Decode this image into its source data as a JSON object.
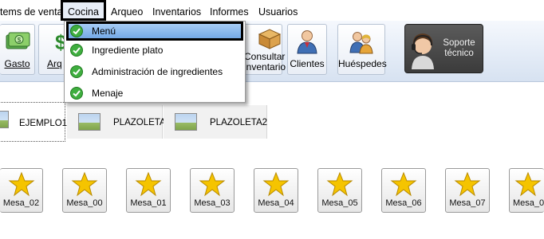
{
  "menubar": {
    "items": [
      "tems de venta",
      "Cocina",
      "Arqueo",
      "Inventarios",
      "Informes",
      "Usuarios"
    ]
  },
  "toolbar": {
    "gasto_label": "Gasto",
    "arqueo_label": "Arq",
    "consultar_label": "Consultar\ninventario",
    "clientes_label": "Clientes",
    "huespedes_label": "Huéspedes",
    "support_label": "Soporte\ntécnico"
  },
  "dropdown": {
    "items": [
      "Menú",
      "Ingrediente plato",
      "Administración de ingredientes",
      "Menaje"
    ],
    "highlighted": "Menú",
    "check_color": "#3fae3f"
  },
  "tabs": [
    "EJEMPLO1",
    "PLAZOLETA",
    "PLAZOLETA2"
  ],
  "mesas": [
    "Mesa_02",
    "Mesa_00",
    "Mesa_01",
    "Mesa_03",
    "Mesa_04",
    "Mesa_05",
    "Mesa_06",
    "Mesa_07",
    "Mesa_0"
  ],
  "colors": {
    "star": "#f5c400",
    "toolbar_bg": "#e4ecf7",
    "highlight": "#8dbcf0"
  }
}
